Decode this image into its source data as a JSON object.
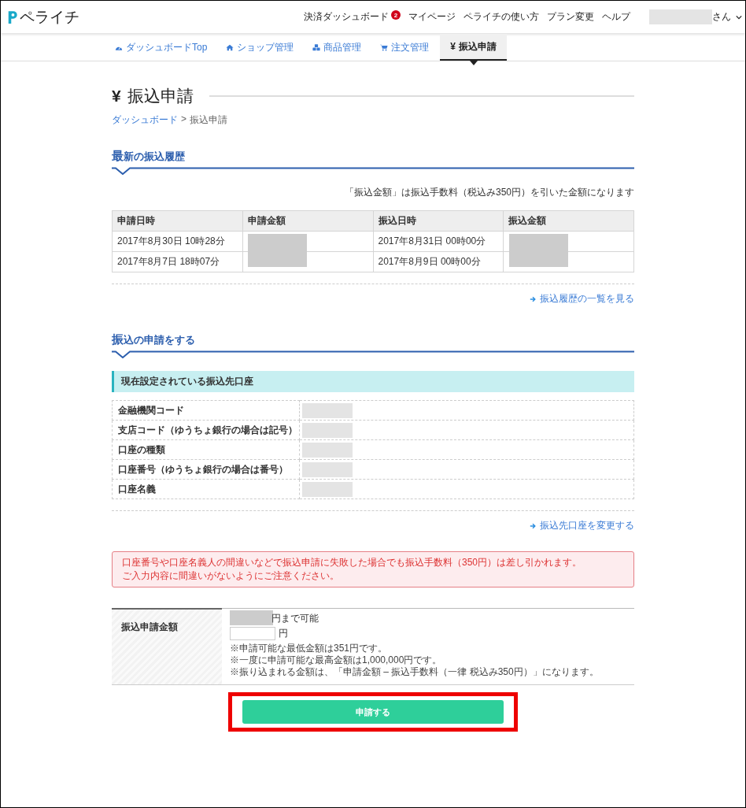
{
  "header": {
    "logo": "ペライチ",
    "nav": [
      {
        "label": "決済ダッシュボード",
        "badge": "2"
      },
      {
        "label": "マイページ"
      },
      {
        "label": "ペライチの使い方"
      },
      {
        "label": "プラン変更"
      },
      {
        "label": "ヘルプ"
      }
    ],
    "user": {
      "redacted": true,
      "suffix": "さん"
    }
  },
  "tabs": [
    {
      "label": "ダッシュボードTop",
      "selected": false
    },
    {
      "label": "ショップ管理",
      "selected": false
    },
    {
      "label": "商品管理",
      "selected": false
    },
    {
      "label": "注文管理",
      "selected": false
    },
    {
      "label": "振込申請",
      "icon_char": "¥",
      "selected": true
    }
  ],
  "page_title": {
    "icon_char": "¥",
    "text": "振込申請"
  },
  "breadcrumb": {
    "items": [
      "ダッシュボード",
      "振込申請"
    ],
    "separator": ">"
  },
  "history": {
    "title": "最新の振込履歴",
    "note": "「振込金額」は振込手数料（税込み350円）を引いた金額になります",
    "columns": [
      {
        "label": "申請日時",
        "redacted": false
      },
      {
        "label": "申請金額",
        "redacted": true
      },
      {
        "label": "振込日時",
        "redacted": false
      },
      {
        "label": "振込金額",
        "redacted": true
      }
    ],
    "rows": [
      [
        "2017年8月30日 10時28分",
        "2017年8月31日 00時00分"
      ],
      [
        "2017年8月7日 18時07分",
        "2017年8月9日 00時00分"
      ]
    ],
    "link": "振込履歴の一覧を見る"
  },
  "apply": {
    "title": "振込の申請をする",
    "account_title": "現在設定されている振込先口座",
    "fields": [
      {
        "label": "金融機関コード",
        "redacted": true
      },
      {
        "label": "支店コード（ゆうちょ銀行の場合は記号）",
        "redacted": true
      },
      {
        "label": "口座の種類",
        "redacted": true
      },
      {
        "label": "口座番号（ゆうちょ銀行の場合は番号）",
        "redacted": true
      },
      {
        "label": "口座名義",
        "redacted": true
      }
    ],
    "link": "振込先口座を変更する",
    "warning": [
      "口座番号や口座名義人の間違いなどで振込申請に失敗した場合でも振込手数料（350円）は差し引かれます。",
      "ご入力内容に間違いがないようにご注意ください。"
    ],
    "amount": {
      "label": "振込申請金額",
      "available": "円まで可能",
      "available_redacted": true,
      "unit": "円",
      "notes": [
        "※申請可能な最低金額は351円です。",
        "※一度に申請可能な最高金額は1,000,000円です。",
        "※振り込まれる金額は、「申請金額 – 振込手数料（一律 税込み350円）」になります。"
      ]
    },
    "submit": {
      "label": "申請する",
      "highlighted": true
    }
  }
}
